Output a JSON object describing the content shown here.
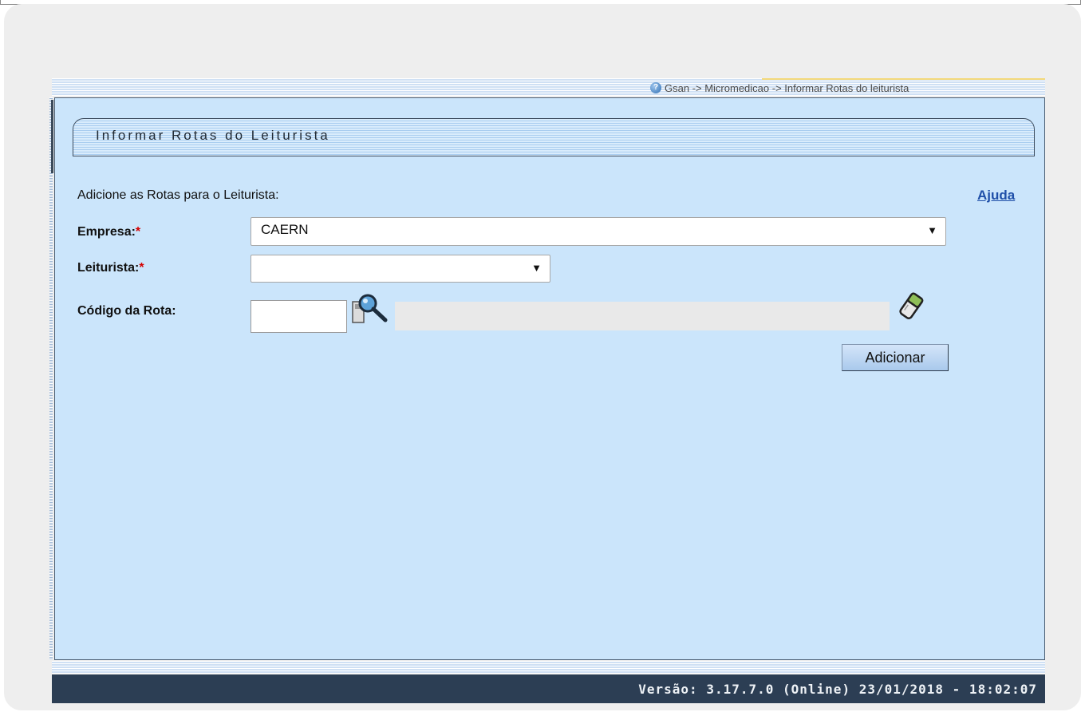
{
  "breadcrumb": {
    "text": "Gsan -> Micromedicao -> Informar Rotas do leiturista",
    "icon": "help-circle-icon"
  },
  "page": {
    "title": "Informar Rotas do Leiturista"
  },
  "form": {
    "intro": "Adicione as Rotas para o Leiturista:",
    "help_label": "Ajuda",
    "required_marker": "*",
    "empresa": {
      "label": "Empresa:",
      "value": "CAERN"
    },
    "leiturista": {
      "label": "Leiturista:",
      "value": ""
    },
    "codigo_rota": {
      "label": "Código da Rota:",
      "value": "",
      "description": ""
    },
    "add_label": "Adicionar"
  },
  "footer": {
    "version": "Versão: 3.17.7.0 (Online) 23/01/2018 - 18:02:07"
  },
  "colors": {
    "panel_bg": "#cbe5fb",
    "footer_bg": "#2c3e54",
    "link": "#1f4fa8",
    "required": "#d40000"
  }
}
